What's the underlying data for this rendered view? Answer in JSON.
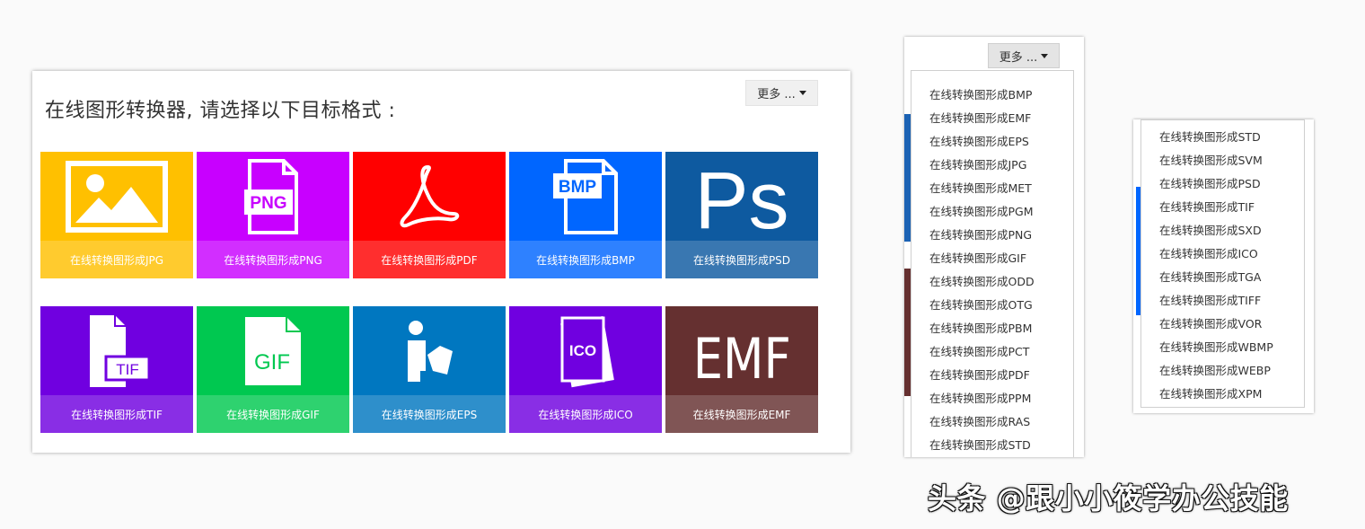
{
  "converter": {
    "title": "在线图形转换器, 请选择以下目标格式 :",
    "more_label": "更多 ...",
    "tiles": [
      {
        "label": "在线转换图形成JPG",
        "color": "#ffc000",
        "icon": "image-icon"
      },
      {
        "label": "在线转换图形成PNG",
        "color": "#c800ff",
        "icon": "png-file-icon"
      },
      {
        "label": "在线转换图形成PDF",
        "color": "#ff0000",
        "icon": "pdf-icon"
      },
      {
        "label": "在线转换图形成BMP",
        "color": "#0066ff",
        "icon": "bmp-file-icon"
      },
      {
        "label": "在线转换图形成PSD",
        "color": "#0e5aa0",
        "icon": "ps-icon"
      },
      {
        "label": "在线转换图形成TIF",
        "color": "#7000e0",
        "icon": "tif-file-icon"
      },
      {
        "label": "在线转换图形成GIF",
        "color": "#00c850",
        "icon": "gif-file-icon"
      },
      {
        "label": "在线转换图形成EPS",
        "color": "#0077c0",
        "icon": "eps-reader-icon"
      },
      {
        "label": "在线转换图形成ICO",
        "color": "#7000e0",
        "icon": "ico-file-icon"
      },
      {
        "label": "在线转换图形成EMF",
        "color": "#653030",
        "icon": "emf-text-icon"
      }
    ],
    "icon_text": {
      "png": "PNG",
      "bmp": "BMP",
      "ps": "Ps",
      "tif": "TIF",
      "gif": "GIF",
      "ico": "ICO",
      "emf": "EMF"
    }
  },
  "dropdown1": {
    "more_label": "更多 ...",
    "items": [
      "在线转换图形成BMP",
      "在线转换图形成EMF",
      "在线转换图形成EPS",
      "在线转换图形成JPG",
      "在线转换图形成MET",
      "在线转换图形成PGM",
      "在线转换图形成PNG",
      "在线转换图形成GIF",
      "在线转换图形成ODD",
      "在线转换图形成OTG",
      "在线转换图形成PBM",
      "在线转换图形成PCT",
      "在线转换图形成PDF",
      "在线转换图形成PPM",
      "在线转换图形成RAS",
      "在线转换图形成STD"
    ]
  },
  "dropdown2": {
    "items": [
      "在线转换图形成STD",
      "在线转换图形成SVM",
      "在线转换图形成PSD",
      "在线转换图形成TIF",
      "在线转换图形成SXD",
      "在线转换图形成ICO",
      "在线转换图形成TGA",
      "在线转换图形成TIFF",
      "在线转换图形成VOR",
      "在线转换图形成WBMP",
      "在线转换图形成WEBP",
      "在线转换图形成XPM"
    ]
  },
  "watermark": "头条 @跟小小筱学办公技能"
}
